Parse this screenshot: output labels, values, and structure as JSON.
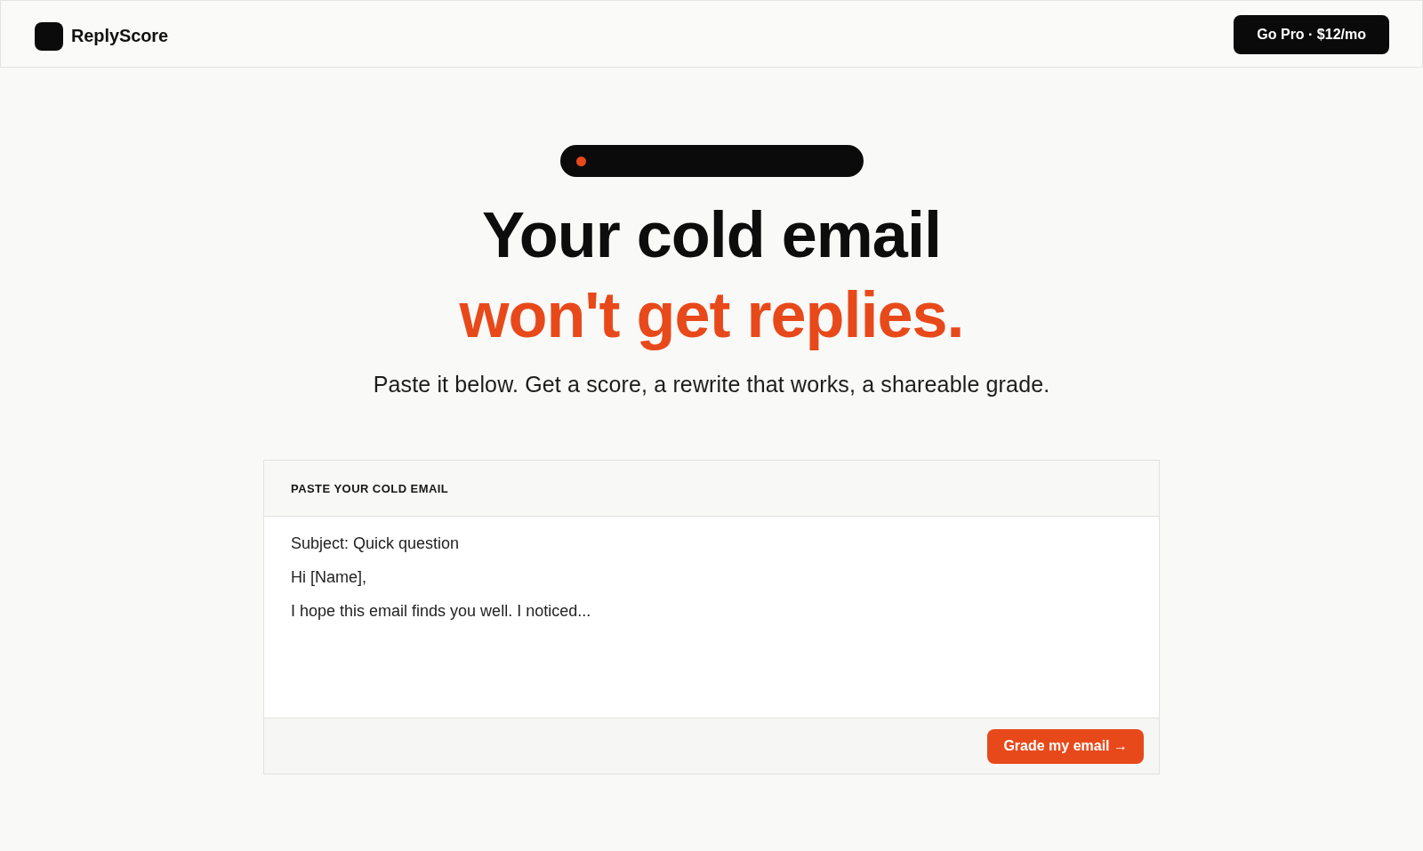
{
  "header": {
    "brand": "ReplyScore",
    "cta": "Go Pro · $12/mo"
  },
  "hero": {
    "headline": "Your cold email",
    "headline_accent": "won't get replies.",
    "subtitle": "Paste it below. Get a score, a rewrite that works, a shareable grade."
  },
  "email_card": {
    "label": "PASTE YOUR COLD EMAIL",
    "email": {
      "value": "Subject: Quick question\nHi [Name],\nI hope this email finds you well. I noticed..."
    },
    "submit": "Grade my email →"
  }
}
